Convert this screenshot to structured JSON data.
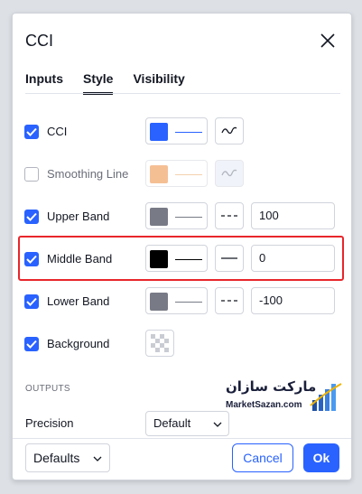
{
  "dialog": {
    "title": "CCI",
    "tabs": [
      {
        "label": "Inputs",
        "active": false
      },
      {
        "label": "Style",
        "active": true
      },
      {
        "label": "Visibility",
        "active": false
      }
    ]
  },
  "rows": [
    {
      "label": "CCI",
      "checked": true,
      "color": "#2962ff",
      "line_color": "#2962ff",
      "value": ""
    },
    {
      "label": "Smoothing Line",
      "checked": false,
      "color": "#f5bf94",
      "line_color": "#f5d1b0",
      "value": ""
    },
    {
      "label": "Upper Band",
      "checked": true,
      "color": "#787b86",
      "line_color": "#787b86",
      "value": "100"
    },
    {
      "label": "Middle Band",
      "checked": true,
      "color": "#000000",
      "line_color": "#000000",
      "value": "0"
    },
    {
      "label": "Lower Band",
      "checked": true,
      "color": "#787b86",
      "line_color": "#787b86",
      "value": "-100"
    },
    {
      "label": "Background",
      "checked": true,
      "color": "",
      "line_color": "",
      "value": ""
    }
  ],
  "outputs": {
    "heading": "OUTPUTS",
    "precision_label": "Precision",
    "precision_value": "Default"
  },
  "footer": {
    "defaults_label": "Defaults",
    "cancel_label": "Cancel",
    "ok_label": "Ok"
  },
  "watermark": {
    "fa": "مارکت سازان",
    "en": "MarketSazan.com"
  },
  "colors": {
    "accent": "#2962ff",
    "highlight": "#e8262b"
  }
}
